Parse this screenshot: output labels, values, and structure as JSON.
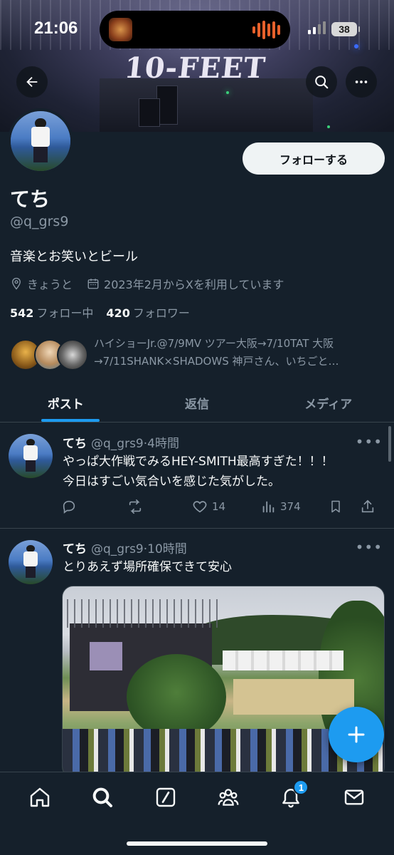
{
  "status_bar": {
    "time": "21:06",
    "battery": "38"
  },
  "banner": {
    "logo_text": "10-FEET"
  },
  "profile": {
    "follow_label": "フォローする",
    "name": "てち",
    "handle": "@q_grs9",
    "bio": "音楽とお笑いとビール",
    "location": "きょうと",
    "joined": "2023年2月からXを利用しています",
    "following_count": "542",
    "following_label": "フォロー中",
    "followers_count": "420",
    "followers_label": "フォロワー",
    "followed_by_line1": "ハイショーJr.@7/9MV ツアー大阪→7/10TAT 大阪",
    "followed_by_line2": "→7/11SHANK×SHADOWS 神戸さん、いちごと…"
  },
  "tabs": [
    {
      "label": "ポスト",
      "active": true
    },
    {
      "label": "返信",
      "active": false
    },
    {
      "label": "メディア",
      "active": false
    }
  ],
  "posts": [
    {
      "name": "てち",
      "handle": "@q_grs9",
      "time": "4時間",
      "text_line1": "やっぱ大作戦でみるHEY-SMITH最高すぎた！！！",
      "text_line2": "今日はすごい気合いを感じた気がした。",
      "likes": "14",
      "views": "374"
    },
    {
      "name": "てち",
      "handle": "@q_grs9",
      "time": "10時間",
      "text_line1": "とりあえず場所確保できて安心"
    }
  ],
  "nav": {
    "notification_badge": "1"
  },
  "colors": {
    "background": "#15202b",
    "accent": "#1d9bf0",
    "secondary_text": "#8b98a5",
    "divider": "#38444d"
  }
}
